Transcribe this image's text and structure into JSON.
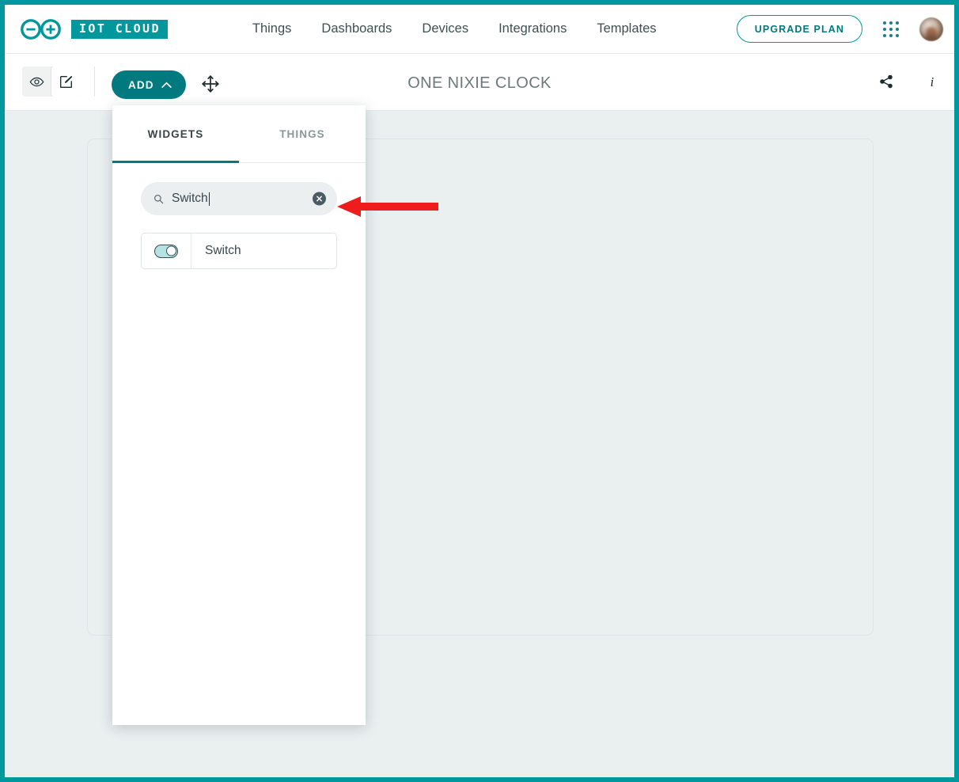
{
  "brand": {
    "logo_icon": "arduino-infinity-icon",
    "badge_text": "IOT CLOUD"
  },
  "nav": {
    "links": [
      {
        "label": "Things"
      },
      {
        "label": "Dashboards"
      },
      {
        "label": "Devices"
      },
      {
        "label": "Integrations"
      },
      {
        "label": "Templates"
      }
    ],
    "upgrade_label": "UPGRADE PLAN",
    "apps_icon": "apps-grid-icon",
    "avatar_icon": "user-avatar"
  },
  "toolbar": {
    "view_icon": "eye-icon",
    "edit_icon": "pencil-edit-icon",
    "add_label": "ADD",
    "add_chevron_icon": "chevron-up-icon",
    "move_icon": "move-arrows-icon",
    "title": "ONE NIXIE CLOCK",
    "share_icon": "share-icon",
    "info_icon": "info-icon"
  },
  "add_panel": {
    "tabs": [
      {
        "label": "WIDGETS",
        "active": true
      },
      {
        "label": "THINGS",
        "active": false
      }
    ],
    "search": {
      "icon": "search-icon",
      "value": "Switch",
      "placeholder": "Search",
      "clear_icon": "clear-circle-icon"
    },
    "results": [
      {
        "label": "Switch",
        "preview_icon": "toggle-switch-icon"
      }
    ]
  },
  "annotation": {
    "arrow_icon": "left-arrow-annotation",
    "color": "#ee1c1c"
  },
  "colors": {
    "teal": "#00979d",
    "teal_dark": "#00797f",
    "canvas_bg": "#eaeff0",
    "text_dark": "#37474f",
    "text_muted": "#6d7878"
  }
}
